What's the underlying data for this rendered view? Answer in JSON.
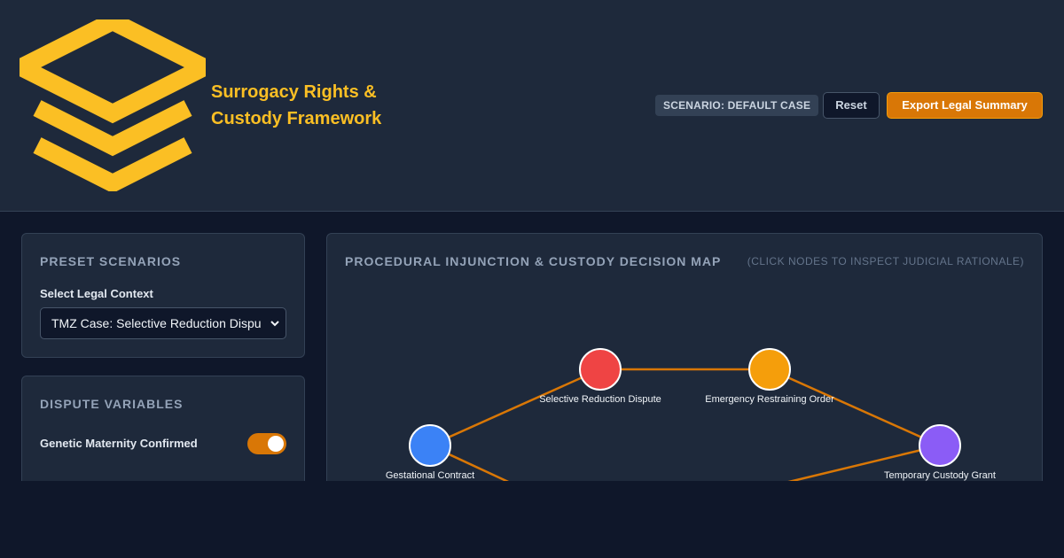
{
  "header": {
    "title_line1": "Surrogacy Rights &",
    "title_line2": "Custody Framework",
    "scenario_badge": "SCENARIO: DEFAULT CASE",
    "reset_label": "Reset",
    "export_label": "Export Legal Summary",
    "logo_icon": "stacked-layers-icon",
    "accent_color": "#fbbf24"
  },
  "presets": {
    "heading": "PRESET SCENARIOS",
    "select_label": "Select Legal Context",
    "selected_value": "TMZ Case: Selective Reduction Dispute"
  },
  "variables": {
    "heading": "DISPUTE VARIABLES",
    "toggle_label": "Genetic Maternity Confirmed",
    "toggle_on": true
  },
  "map": {
    "heading": "PROCEDURAL INJUNCTION & CUSTODY DECISION MAP",
    "hint": "(CLICK NODES TO INSPECT JUDICIAL RATIONALE)",
    "edge_color": "#d97706",
    "nodes": [
      {
        "id": "gestational",
        "label": "Gestational Contract",
        "color": "#3b82f6"
      },
      {
        "id": "reduction",
        "label": "Selective Reduction Dispute",
        "color": "#ef4444"
      },
      {
        "id": "restraining",
        "label": "Emergency Restraining Order",
        "color": "#f59e0b"
      },
      {
        "id": "custody",
        "label": "Temporary Custody Grant",
        "color": "#8b5cf6"
      }
    ]
  }
}
